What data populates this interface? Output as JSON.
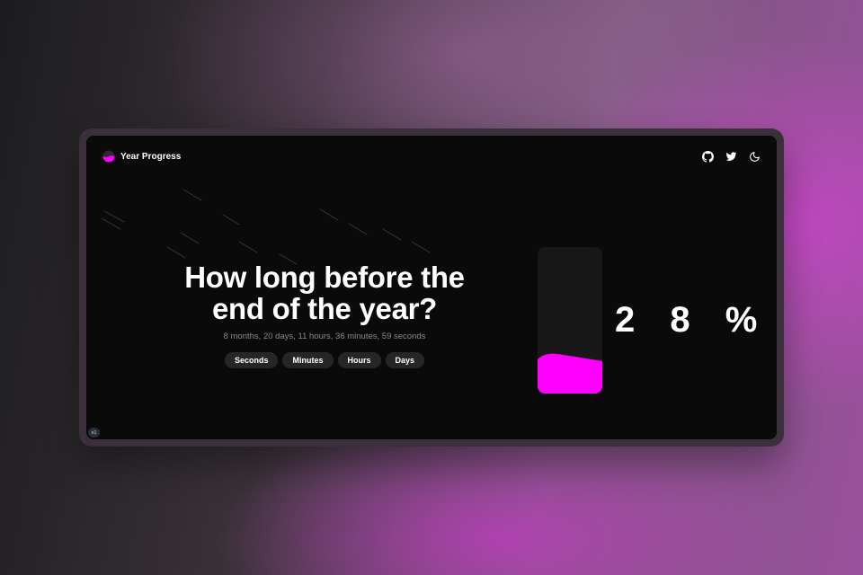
{
  "app": {
    "name": "Year Progress",
    "logo_icon": "half-moon-logo-icon",
    "accent_color": "#ff00ff"
  },
  "header": {
    "actions": [
      {
        "icon": "github-icon"
      },
      {
        "icon": "twitter-icon"
      },
      {
        "icon": "moon-icon"
      }
    ]
  },
  "hero": {
    "title_line1": "How long before the",
    "title_line2": "end of the year?",
    "countdown": "8 months, 20 days, 11 hours, 36 minutes, 59 seconds"
  },
  "units": [
    "Seconds",
    "Minutes",
    "Hours",
    "Days"
  ],
  "progress": {
    "percent": 28,
    "label": "2 8 %"
  },
  "badge": {
    "label": "x1"
  }
}
